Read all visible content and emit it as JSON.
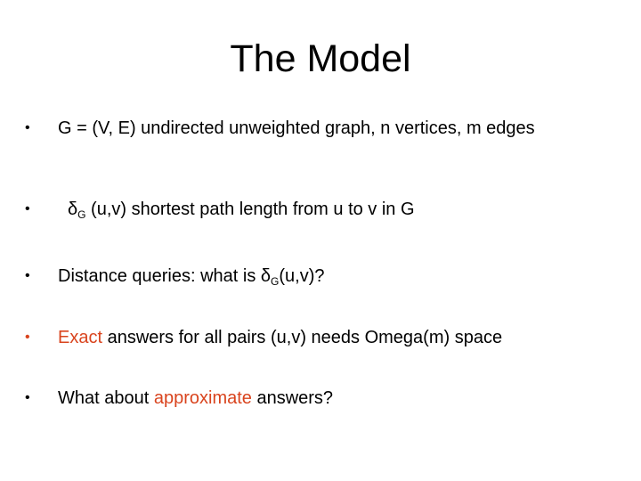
{
  "slide": {
    "title": "The Model",
    "accent_color": "#D9441E",
    "bullet_glyph": "•",
    "bullets": [
      {
        "text": "G = (V, E) undirected unweighted graph, n vertices, m edges"
      },
      {
        "symbol": "δ",
        "subscript": "G",
        "rest": " (u,v) shortest path length from u to v in G"
      },
      {
        "prefix": "Distance queries: what is ",
        "symbol": "δ",
        "subscript": "G",
        "suffix": "(u,v)?"
      },
      {
        "highlight": "Exact",
        "rest": " answers for all pairs (u,v) needs Omega(m) space"
      },
      {
        "prefix": "What about ",
        "highlight": "approximate",
        "suffix": " answers?"
      }
    ]
  }
}
